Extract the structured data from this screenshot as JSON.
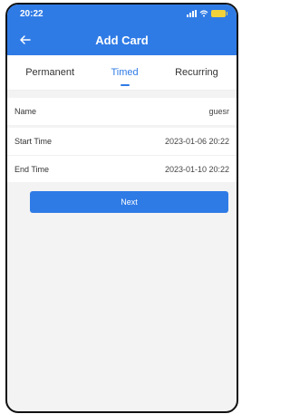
{
  "status": {
    "time": "20:22"
  },
  "header": {
    "title": "Add Card",
    "back_icon": "arrow-left-icon"
  },
  "tabs": [
    {
      "label": "Permanent",
      "active": false
    },
    {
      "label": "Timed",
      "active": true
    },
    {
      "label": "Recurring",
      "active": false
    }
  ],
  "form": {
    "name": {
      "label": "Name",
      "value": "guesr"
    },
    "start_time": {
      "label": "Start Time",
      "value": "2023-01-06 20:22"
    },
    "end_time": {
      "label": "End Time",
      "value": "2023-01-10 20:22"
    }
  },
  "next_button": {
    "label": "Next"
  },
  "colors": {
    "primary": "#2f7be6",
    "background": "#f3f3f3"
  }
}
